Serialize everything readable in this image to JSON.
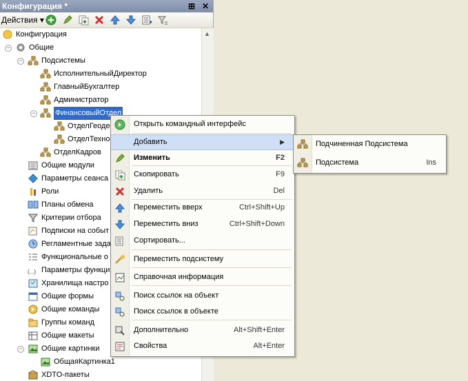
{
  "window": {
    "title": "Конфигурация *",
    "pin_glyph": "⊞",
    "close_glyph": "✕"
  },
  "toolbar": {
    "actions_label": "Действия",
    "actions_arrow": "▾"
  },
  "tree": {
    "root": "Конфигурация",
    "common": "Общие",
    "subsystems": "Подсистемы",
    "sub_items": [
      "ИсполнительныйДиректор",
      "ГлавныйБухгалтер",
      "Администратор",
      "ФинансовыйОтдел"
    ],
    "fin_children": [
      "ОтделГеоде",
      "ОтделТехно"
    ],
    "hr": "ОтделКадров",
    "items": [
      "Общие модули",
      "Параметры сеанса",
      "Роли",
      "Планы обмена",
      "Критерии отбора",
      "Подписки на событ",
      "Регламентные зада",
      "Функциональные о",
      "Параметры функци",
      "Хранилища настро",
      "Общие формы",
      "Общие команды",
      "Группы команд",
      "Общие макеты",
      "Общие картинки"
    ],
    "picture_child": "ОбщаяКартинка1",
    "xdto": "XDTO-пакеты",
    "params_icon_glyph": "(...)"
  },
  "context_menu": {
    "items": [
      {
        "label": "Открыть командный интерфейс",
        "key": ""
      },
      {
        "label": "Добавить",
        "key": "▶"
      },
      {
        "label": "Изменить",
        "key": "F2"
      },
      {
        "label": "Скопировать",
        "key": "F9"
      },
      {
        "label": "Удалить",
        "key": "Del"
      },
      {
        "label": "Переместить вверх",
        "key": "Ctrl+Shift+Up"
      },
      {
        "label": "Переместить вниз",
        "key": "Ctrl+Shift+Down"
      },
      {
        "label": "Сортировать...",
        "key": ""
      },
      {
        "label": "Переместить подсистему",
        "key": ""
      },
      {
        "label": "Справочная информация",
        "key": ""
      },
      {
        "label": "Поиск ссылок на объект",
        "key": ""
      },
      {
        "label": "Поиск ссылок в объекте",
        "key": ""
      },
      {
        "label": "Дополнительно",
        "key": "Alt+Shift+Enter"
      },
      {
        "label": "Свойства",
        "key": "Alt+Enter"
      }
    ]
  },
  "submenu": {
    "items": [
      {
        "label": "Подчиненная Подсистема",
        "key": ""
      },
      {
        "label": "Подсистема",
        "key": "Ins"
      }
    ]
  },
  "colors": {
    "accent": "#3169c6",
    "highlight": "#cfe0f6",
    "title_bar": "#8a98b3"
  }
}
